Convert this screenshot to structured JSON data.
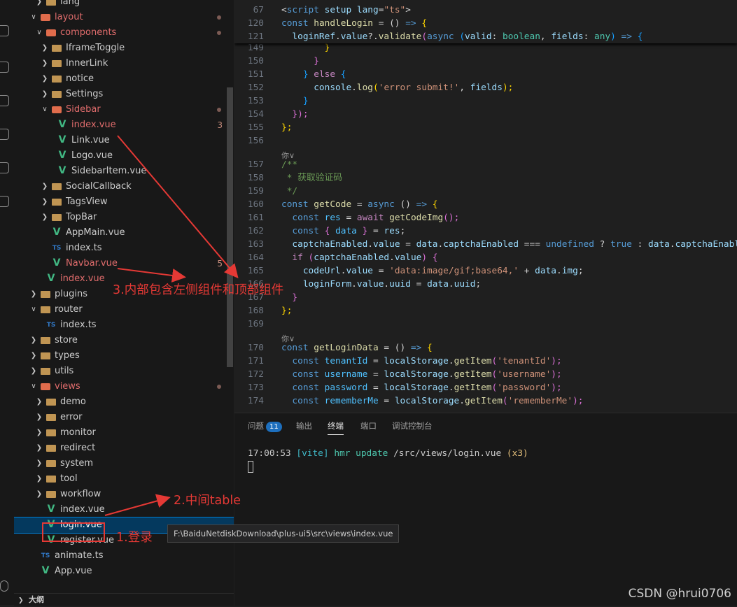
{
  "explorer": {
    "rows": [
      {
        "label": "lang",
        "icon": "folder-icon",
        "expanded": false,
        "color": "normal"
      },
      {
        "label": "layout",
        "icon": "folder-icon",
        "expanded": true,
        "color": "err",
        "dot": true
      },
      {
        "label": "components",
        "icon": "folder-icon",
        "expanded": true,
        "color": "err",
        "dot": true
      },
      {
        "label": "IframeToggle",
        "icon": "folder-icon",
        "expanded": false,
        "color": "normal"
      },
      {
        "label": "InnerLink",
        "icon": "folder-icon",
        "expanded": false,
        "color": "normal"
      },
      {
        "label": "notice",
        "icon": "folder-icon",
        "expanded": false,
        "color": "normal"
      },
      {
        "label": "Settings",
        "icon": "folder-icon",
        "expanded": false,
        "color": "normal"
      },
      {
        "label": "Sidebar",
        "icon": "folder-icon",
        "expanded": true,
        "color": "err",
        "dot": true
      },
      {
        "label": "index.vue",
        "icon": "vue-icon",
        "color": "err",
        "badge": "3"
      },
      {
        "label": "Link.vue",
        "icon": "vue-icon",
        "color": "normal"
      },
      {
        "label": "Logo.vue",
        "icon": "vue-icon",
        "color": "normal"
      },
      {
        "label": "SidebarItem.vue",
        "icon": "vue-icon",
        "color": "normal"
      },
      {
        "label": "SocialCallback",
        "icon": "folder-icon",
        "expanded": false,
        "color": "normal"
      },
      {
        "label": "TagsView",
        "icon": "folder-icon",
        "expanded": false,
        "color": "normal"
      },
      {
        "label": "TopBar",
        "icon": "folder-icon",
        "expanded": false,
        "color": "normal"
      },
      {
        "label": "AppMain.vue",
        "icon": "vue-icon",
        "color": "normal"
      },
      {
        "label": "index.ts",
        "icon": "ts-icon",
        "color": "normal"
      },
      {
        "label": "Navbar.vue",
        "icon": "vue-icon",
        "color": "err",
        "badge": "5"
      },
      {
        "label": "index.vue",
        "icon": "vue-icon",
        "color": "err"
      },
      {
        "label": "plugins",
        "icon": "folder-icon",
        "expanded": false,
        "color": "normal"
      },
      {
        "label": "router",
        "icon": "folder-icon",
        "expanded": true,
        "color": "normal"
      },
      {
        "label": "index.ts",
        "icon": "ts-icon",
        "color": "normal"
      },
      {
        "label": "store",
        "icon": "folder-icon",
        "expanded": false,
        "color": "normal"
      },
      {
        "label": "types",
        "icon": "folder-icon",
        "expanded": false,
        "color": "normal"
      },
      {
        "label": "utils",
        "icon": "folder-icon",
        "expanded": false,
        "color": "normal"
      },
      {
        "label": "views",
        "icon": "folder-icon",
        "expanded": true,
        "color": "err",
        "dot": true
      },
      {
        "label": "demo",
        "icon": "folder-icon",
        "expanded": false,
        "color": "normal"
      },
      {
        "label": "error",
        "icon": "folder-icon",
        "expanded": false,
        "color": "normal"
      },
      {
        "label": "monitor",
        "icon": "folder-icon",
        "expanded": false,
        "color": "normal"
      },
      {
        "label": "redirect",
        "icon": "folder-icon",
        "expanded": false,
        "color": "normal"
      },
      {
        "label": "system",
        "icon": "folder-icon",
        "expanded": false,
        "color": "normal"
      },
      {
        "label": "tool",
        "icon": "folder-icon",
        "expanded": false,
        "color": "normal"
      },
      {
        "label": "workflow",
        "icon": "folder-icon",
        "expanded": false,
        "color": "normal"
      },
      {
        "label": "index.vue",
        "icon": "vue-icon",
        "color": "normal"
      },
      {
        "label": "login.vue",
        "icon": "vue-icon",
        "color": "normal",
        "selected": true
      },
      {
        "label": "register.vue",
        "icon": "vue-icon",
        "color": "normal"
      },
      {
        "label": "animate.ts",
        "icon": "ts-icon",
        "color": "normal"
      },
      {
        "label": "App.vue",
        "icon": "vue-icon",
        "color": "normal"
      }
    ],
    "bottom_label": "大纲",
    "tooltip": "F:\\BaiduNetdiskDownload\\plus-ui5\\src\\views\\index.vue"
  },
  "editor": {
    "sticky": [
      {
        "ln": "67",
        "segs": [
          [
            "<",
            "p"
          ],
          [
            "script",
            "k"
          ],
          [
            " setup ",
            "v"
          ],
          [
            "lang",
            "v"
          ],
          [
            "=",
            "p"
          ],
          [
            "\"ts\"",
            "s"
          ],
          [
            ">",
            "p"
          ]
        ]
      },
      {
        "ln": "120",
        "segs": [
          [
            "const ",
            "k"
          ],
          [
            "handleLogin",
            "f"
          ],
          [
            " = () ",
            "p"
          ],
          [
            "=>",
            "k"
          ],
          [
            " {",
            "br"
          ]
        ]
      },
      {
        "ln": "121",
        "segs": [
          [
            "  loginRef",
            "v"
          ],
          [
            ".",
            "p"
          ],
          [
            "value",
            "v"
          ],
          [
            "?.",
            "p"
          ],
          [
            "validate",
            "f"
          ],
          [
            "(",
            "br2"
          ],
          [
            "async ",
            "k"
          ],
          [
            "(",
            "br3"
          ],
          [
            "valid",
            "v"
          ],
          [
            ": ",
            "p"
          ],
          [
            "boolean",
            "t"
          ],
          [
            ", ",
            "p"
          ],
          [
            "fields",
            "v"
          ],
          [
            ": ",
            "p"
          ],
          [
            "any",
            "t"
          ],
          [
            ")",
            "br3"
          ],
          [
            " => ",
            "k"
          ],
          [
            "{",
            "br3"
          ]
        ]
      }
    ],
    "lines": [
      {
        "ln": "149",
        "segs": [
          [
            "        }",
            "br"
          ]
        ]
      },
      {
        "ln": "150",
        "segs": [
          [
            "      }",
            "br2"
          ]
        ]
      },
      {
        "ln": "151",
        "segs": [
          [
            "    } ",
            "br3"
          ],
          [
            "else ",
            "kw"
          ],
          [
            "{",
            "br3"
          ]
        ]
      },
      {
        "ln": "152",
        "segs": [
          [
            "      console",
            "v"
          ],
          [
            ".",
            "p"
          ],
          [
            "log",
            "f"
          ],
          [
            "(",
            "br"
          ],
          [
            "'error submit!'",
            "s"
          ],
          [
            ", ",
            "p"
          ],
          [
            "fields",
            "v"
          ],
          [
            ");",
            "br"
          ]
        ]
      },
      {
        "ln": "153",
        "segs": [
          [
            "    }",
            "br3"
          ]
        ]
      },
      {
        "ln": "154",
        "segs": [
          [
            "  });",
            "br2"
          ]
        ]
      },
      {
        "ln": "155",
        "segs": [
          [
            "};",
            "br"
          ]
        ]
      },
      {
        "ln": "156",
        "segs": []
      },
      {
        "hint": "你∨"
      },
      {
        "ln": "157",
        "segs": [
          [
            "/**",
            "cm"
          ]
        ]
      },
      {
        "ln": "158",
        "segs": [
          [
            " * 获取验证码",
            "cm"
          ]
        ]
      },
      {
        "ln": "159",
        "segs": [
          [
            " */",
            "cm"
          ]
        ]
      },
      {
        "ln": "160",
        "segs": [
          [
            "const ",
            "k"
          ],
          [
            "getCode",
            "f"
          ],
          [
            " = ",
            "p"
          ],
          [
            "async ",
            "k"
          ],
          [
            "() ",
            "p"
          ],
          [
            "=> ",
            "k"
          ],
          [
            "{",
            "br"
          ]
        ]
      },
      {
        "ln": "161",
        "segs": [
          [
            "  const ",
            "k"
          ],
          [
            "res",
            "c"
          ],
          [
            " = ",
            "p"
          ],
          [
            "await ",
            "kw"
          ],
          [
            "getCodeImg",
            "f"
          ],
          [
            "();",
            "br2"
          ]
        ]
      },
      {
        "ln": "162",
        "segs": [
          [
            "  const ",
            "k"
          ],
          [
            "{ ",
            "br2"
          ],
          [
            "data",
            "c"
          ],
          [
            " } ",
            "br2"
          ],
          [
            "= ",
            "p"
          ],
          [
            "res",
            "v"
          ],
          [
            ";",
            "p"
          ]
        ]
      },
      {
        "ln": "163",
        "segs": [
          [
            "  captchaEnabled",
            "v"
          ],
          [
            ".",
            "p"
          ],
          [
            "value",
            "v"
          ],
          [
            " = ",
            "p"
          ],
          [
            "data",
            "v"
          ],
          [
            ".",
            "p"
          ],
          [
            "captchaEnabled",
            "v"
          ],
          [
            " === ",
            "p"
          ],
          [
            "undefined",
            "k"
          ],
          [
            " ? ",
            "p"
          ],
          [
            "true",
            "k"
          ],
          [
            " : ",
            "p"
          ],
          [
            "data",
            "v"
          ],
          [
            ".",
            "p"
          ],
          [
            "captchaEnabl",
            "v"
          ]
        ]
      },
      {
        "ln": "164",
        "segs": [
          [
            "  if ",
            "kw"
          ],
          [
            "(",
            "br2"
          ],
          [
            "captchaEnabled",
            "v"
          ],
          [
            ".",
            "p"
          ],
          [
            "value",
            "v"
          ],
          [
            ") ",
            "br2"
          ],
          [
            "{",
            "br2"
          ]
        ]
      },
      {
        "ln": "165",
        "segs": [
          [
            "    codeUrl",
            "v"
          ],
          [
            ".",
            "p"
          ],
          [
            "value",
            "v"
          ],
          [
            " = ",
            "p"
          ],
          [
            "'data:image/gif;base64,'",
            "s"
          ],
          [
            " + ",
            "p"
          ],
          [
            "data",
            "v"
          ],
          [
            ".",
            "p"
          ],
          [
            "img",
            "v"
          ],
          [
            ";",
            "p"
          ]
        ]
      },
      {
        "ln": "166",
        "segs": [
          [
            "    loginForm",
            "v"
          ],
          [
            ".",
            "p"
          ],
          [
            "value",
            "v"
          ],
          [
            ".",
            "p"
          ],
          [
            "uuid",
            "v"
          ],
          [
            " = ",
            "p"
          ],
          [
            "data",
            "v"
          ],
          [
            ".",
            "p"
          ],
          [
            "uuid",
            "v"
          ],
          [
            ";",
            "p"
          ]
        ]
      },
      {
        "ln": "167",
        "segs": [
          [
            "  }",
            "br2"
          ]
        ]
      },
      {
        "ln": "168",
        "segs": [
          [
            "};",
            "br"
          ]
        ]
      },
      {
        "ln": "169",
        "segs": []
      },
      {
        "hint": "你∨"
      },
      {
        "ln": "170",
        "segs": [
          [
            "const ",
            "k"
          ],
          [
            "getLoginData",
            "f"
          ],
          [
            " = () ",
            "p"
          ],
          [
            "=> ",
            "k"
          ],
          [
            "{",
            "br"
          ]
        ]
      },
      {
        "ln": "171",
        "segs": [
          [
            "  const ",
            "k"
          ],
          [
            "tenantId",
            "c"
          ],
          [
            " = ",
            "p"
          ],
          [
            "localStorage",
            "v"
          ],
          [
            ".",
            "p"
          ],
          [
            "getItem",
            "f"
          ],
          [
            "(",
            "br2"
          ],
          [
            "'tenantId'",
            "s"
          ],
          [
            ");",
            "br2"
          ]
        ]
      },
      {
        "ln": "172",
        "segs": [
          [
            "  const ",
            "k"
          ],
          [
            "username",
            "c"
          ],
          [
            " = ",
            "p"
          ],
          [
            "localStorage",
            "v"
          ],
          [
            ".",
            "p"
          ],
          [
            "getItem",
            "f"
          ],
          [
            "(",
            "br2"
          ],
          [
            "'username'",
            "s"
          ],
          [
            ");",
            "br2"
          ]
        ]
      },
      {
        "ln": "173",
        "segs": [
          [
            "  const ",
            "k"
          ],
          [
            "password",
            "c"
          ],
          [
            " = ",
            "p"
          ],
          [
            "localStorage",
            "v"
          ],
          [
            ".",
            "p"
          ],
          [
            "getItem",
            "f"
          ],
          [
            "(",
            "br2"
          ],
          [
            "'password'",
            "s"
          ],
          [
            ");",
            "br2"
          ]
        ]
      },
      {
        "ln": "174",
        "segs": [
          [
            "  const ",
            "k"
          ],
          [
            "rememberMe",
            "c"
          ],
          [
            " = ",
            "p"
          ],
          [
            "localStorage",
            "v"
          ],
          [
            ".",
            "p"
          ],
          [
            "getItem",
            "f"
          ],
          [
            "(",
            "br2"
          ],
          [
            "'rememberMe'",
            "s"
          ],
          [
            ");",
            "br2"
          ]
        ]
      }
    ]
  },
  "panel": {
    "tabs": [
      {
        "label": "问题",
        "badge": "11"
      },
      {
        "label": "输出"
      },
      {
        "label": "终端",
        "active": true
      },
      {
        "label": "端口"
      },
      {
        "label": "调试控制台"
      }
    ],
    "terminal_time": "17:00:53",
    "terminal_tag": "[vite]",
    "terminal_action": "hmr update",
    "terminal_path": "/src/views/login.vue",
    "terminal_count": "(x3)"
  },
  "annotations": {
    "a1": "1.登录",
    "a2": "2.中间table",
    "a3": "3.内部包含左侧组件和顶部组件"
  },
  "watermark": "CSDN @hrui0706"
}
